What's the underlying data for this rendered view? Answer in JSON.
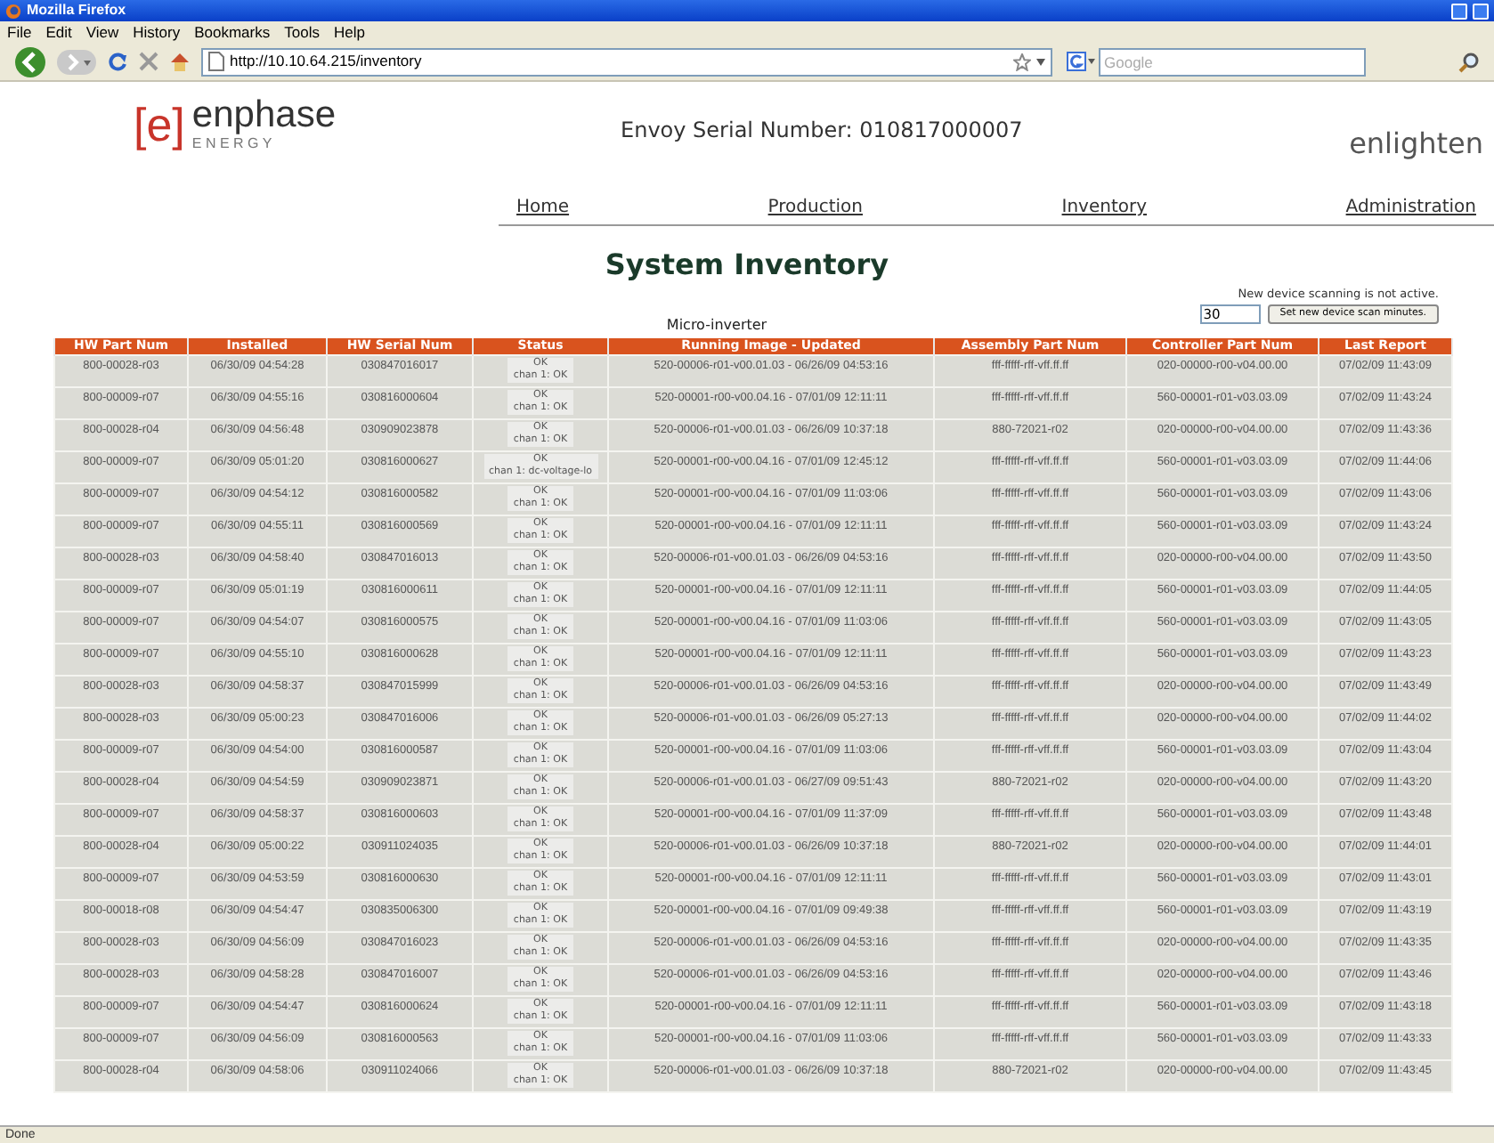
{
  "window": {
    "title": "Mozilla Firefox"
  },
  "menu": [
    "File",
    "Edit",
    "View",
    "History",
    "Bookmarks",
    "Tools",
    "Help"
  ],
  "toolbar": {
    "url": "http://10.10.64.215/inventory",
    "search_placeholder": "Google"
  },
  "header": {
    "logo_bracket": "[e]",
    "logo_word": "enphase",
    "logo_sub": "E N E R G Y",
    "serial": "Envoy Serial Number: 010817000007",
    "brand": "enlighten"
  },
  "nav": [
    "Home",
    "Production",
    "Inventory",
    "Administration"
  ],
  "title": "System Inventory",
  "scan": {
    "message": "New device scanning is not active.",
    "minutes": "30",
    "button": "Set new device scan minutes."
  },
  "table": {
    "caption": "Micro-inverter",
    "columns": [
      "HW Part Num",
      "Installed",
      "HW Serial Num",
      "Status",
      "Running Image - Updated",
      "Assembly Part Num",
      "Controller Part Num",
      "Last Report"
    ],
    "rows": [
      [
        "800-00028-r03",
        "06/30/09 04:54:28",
        "030847016017",
        [
          "OK",
          "chan 1: OK"
        ],
        "520-00006-r01-v00.01.03 - 06/26/09 04:53:16",
        "fff-fffff-rff-vff.ff.ff",
        "020-00000-r00-v04.00.00",
        "07/02/09 11:43:09"
      ],
      [
        "800-00009-r07",
        "06/30/09 04:55:16",
        "030816000604",
        [
          "OK",
          "chan 1: OK"
        ],
        "520-00001-r00-v00.04.16 - 07/01/09 12:11:11",
        "fff-fffff-rff-vff.ff.ff",
        "560-00001-r01-v03.03.09",
        "07/02/09 11:43:24"
      ],
      [
        "800-00028-r04",
        "06/30/09 04:56:48",
        "030909023878",
        [
          "OK",
          "chan 1: OK"
        ],
        "520-00006-r01-v00.01.03 - 06/26/09 10:37:18",
        "880-72021-r02",
        "020-00000-r00-v04.00.00",
        "07/02/09 11:43:36"
      ],
      [
        "800-00009-r07",
        "06/30/09 05:01:20",
        "030816000627",
        [
          "OK",
          "chan 1: dc-voltage-lo"
        ],
        "520-00001-r00-v00.04.16 - 07/01/09 12:45:12",
        "fff-fffff-rff-vff.ff.ff",
        "560-00001-r01-v03.03.09",
        "07/02/09 11:44:06"
      ],
      [
        "800-00009-r07",
        "06/30/09 04:54:12",
        "030816000582",
        [
          "OK",
          "chan 1: OK"
        ],
        "520-00001-r00-v00.04.16 - 07/01/09 11:03:06",
        "fff-fffff-rff-vff.ff.ff",
        "560-00001-r01-v03.03.09",
        "07/02/09 11:43:06"
      ],
      [
        "800-00009-r07",
        "06/30/09 04:55:11",
        "030816000569",
        [
          "OK",
          "chan 1: OK"
        ],
        "520-00001-r00-v00.04.16 - 07/01/09 12:11:11",
        "fff-fffff-rff-vff.ff.ff",
        "560-00001-r01-v03.03.09",
        "07/02/09 11:43:24"
      ],
      [
        "800-00028-r03",
        "06/30/09 04:58:40",
        "030847016013",
        [
          "OK",
          "chan 1: OK"
        ],
        "520-00006-r01-v00.01.03 - 06/26/09 04:53:16",
        "fff-fffff-rff-vff.ff.ff",
        "020-00000-r00-v04.00.00",
        "07/02/09 11:43:50"
      ],
      [
        "800-00009-r07",
        "06/30/09 05:01:19",
        "030816000611",
        [
          "OK",
          "chan 1: OK"
        ],
        "520-00001-r00-v00.04.16 - 07/01/09 12:11:11",
        "fff-fffff-rff-vff.ff.ff",
        "560-00001-r01-v03.03.09",
        "07/02/09 11:44:05"
      ],
      [
        "800-00009-r07",
        "06/30/09 04:54:07",
        "030816000575",
        [
          "OK",
          "chan 1: OK"
        ],
        "520-00001-r00-v00.04.16 - 07/01/09 11:03:06",
        "fff-fffff-rff-vff.ff.ff",
        "560-00001-r01-v03.03.09",
        "07/02/09 11:43:05"
      ],
      [
        "800-00009-r07",
        "06/30/09 04:55:10",
        "030816000628",
        [
          "OK",
          "chan 1: OK"
        ],
        "520-00001-r00-v00.04.16 - 07/01/09 12:11:11",
        "fff-fffff-rff-vff.ff.ff",
        "560-00001-r01-v03.03.09",
        "07/02/09 11:43:23"
      ],
      [
        "800-00028-r03",
        "06/30/09 04:58:37",
        "030847015999",
        [
          "OK",
          "chan 1: OK"
        ],
        "520-00006-r01-v00.01.03 - 06/26/09 04:53:16",
        "fff-fffff-rff-vff.ff.ff",
        "020-00000-r00-v04.00.00",
        "07/02/09 11:43:49"
      ],
      [
        "800-00028-r03",
        "06/30/09 05:00:23",
        "030847016006",
        [
          "OK",
          "chan 1: OK"
        ],
        "520-00006-r01-v00.01.03 - 06/26/09 05:27:13",
        "fff-fffff-rff-vff.ff.ff",
        "020-00000-r00-v04.00.00",
        "07/02/09 11:44:02"
      ],
      [
        "800-00009-r07",
        "06/30/09 04:54:00",
        "030816000587",
        [
          "OK",
          "chan 1: OK"
        ],
        "520-00001-r00-v00.04.16 - 07/01/09 11:03:06",
        "fff-fffff-rff-vff.ff.ff",
        "560-00001-r01-v03.03.09",
        "07/02/09 11:43:04"
      ],
      [
        "800-00028-r04",
        "06/30/09 04:54:59",
        "030909023871",
        [
          "OK",
          "chan 1: OK"
        ],
        "520-00006-r01-v00.01.03 - 06/27/09 09:51:43",
        "880-72021-r02",
        "020-00000-r00-v04.00.00",
        "07/02/09 11:43:20"
      ],
      [
        "800-00009-r07",
        "06/30/09 04:58:37",
        "030816000603",
        [
          "OK",
          "chan 1: OK"
        ],
        "520-00001-r00-v00.04.16 - 07/01/09 11:37:09",
        "fff-fffff-rff-vff.ff.ff",
        "560-00001-r01-v03.03.09",
        "07/02/09 11:43:48"
      ],
      [
        "800-00028-r04",
        "06/30/09 05:00:22",
        "030911024035",
        [
          "OK",
          "chan 1: OK"
        ],
        "520-00006-r01-v00.01.03 - 06/26/09 10:37:18",
        "880-72021-r02",
        "020-00000-r00-v04.00.00",
        "07/02/09 11:44:01"
      ],
      [
        "800-00009-r07",
        "06/30/09 04:53:59",
        "030816000630",
        [
          "OK",
          "chan 1: OK"
        ],
        "520-00001-r00-v00.04.16 - 07/01/09 12:11:11",
        "fff-fffff-rff-vff.ff.ff",
        "560-00001-r01-v03.03.09",
        "07/02/09 11:43:01"
      ],
      [
        "800-00018-r08",
        "06/30/09 04:54:47",
        "030835006300",
        [
          "OK",
          "chan 1: OK"
        ],
        "520-00001-r00-v00.04.16 - 07/01/09 09:49:38",
        "fff-fffff-rff-vff.ff.ff",
        "560-00001-r01-v03.03.09",
        "07/02/09 11:43:19"
      ],
      [
        "800-00028-r03",
        "06/30/09 04:56:09",
        "030847016023",
        [
          "OK",
          "chan 1: OK"
        ],
        "520-00006-r01-v00.01.03 - 06/26/09 04:53:16",
        "fff-fffff-rff-vff.ff.ff",
        "020-00000-r00-v04.00.00",
        "07/02/09 11:43:35"
      ],
      [
        "800-00028-r03",
        "06/30/09 04:58:28",
        "030847016007",
        [
          "OK",
          "chan 1: OK"
        ],
        "520-00006-r01-v00.01.03 - 06/26/09 04:53:16",
        "fff-fffff-rff-vff.ff.ff",
        "020-00000-r00-v04.00.00",
        "07/02/09 11:43:46"
      ],
      [
        "800-00009-r07",
        "06/30/09 04:54:47",
        "030816000624",
        [
          "OK",
          "chan 1: OK"
        ],
        "520-00001-r00-v00.04.16 - 07/01/09 12:11:11",
        "fff-fffff-rff-vff.ff.ff",
        "560-00001-r01-v03.03.09",
        "07/02/09 11:43:18"
      ],
      [
        "800-00009-r07",
        "06/30/09 04:56:09",
        "030816000563",
        [
          "OK",
          "chan 1: OK"
        ],
        "520-00001-r00-v00.04.16 - 07/01/09 11:03:06",
        "fff-fffff-rff-vff.ff.ff",
        "560-00001-r01-v03.03.09",
        "07/02/09 11:43:33"
      ],
      [
        "800-00028-r04",
        "06/30/09 04:58:06",
        "030911024066",
        [
          "OK",
          "chan 1: OK"
        ],
        "520-00006-r01-v00.01.03 - 06/26/09 10:37:18",
        "880-72021-r02",
        "020-00000-r00-v04.00.00",
        "07/02/09 11:43:45"
      ]
    ]
  },
  "status_bar": "Done"
}
